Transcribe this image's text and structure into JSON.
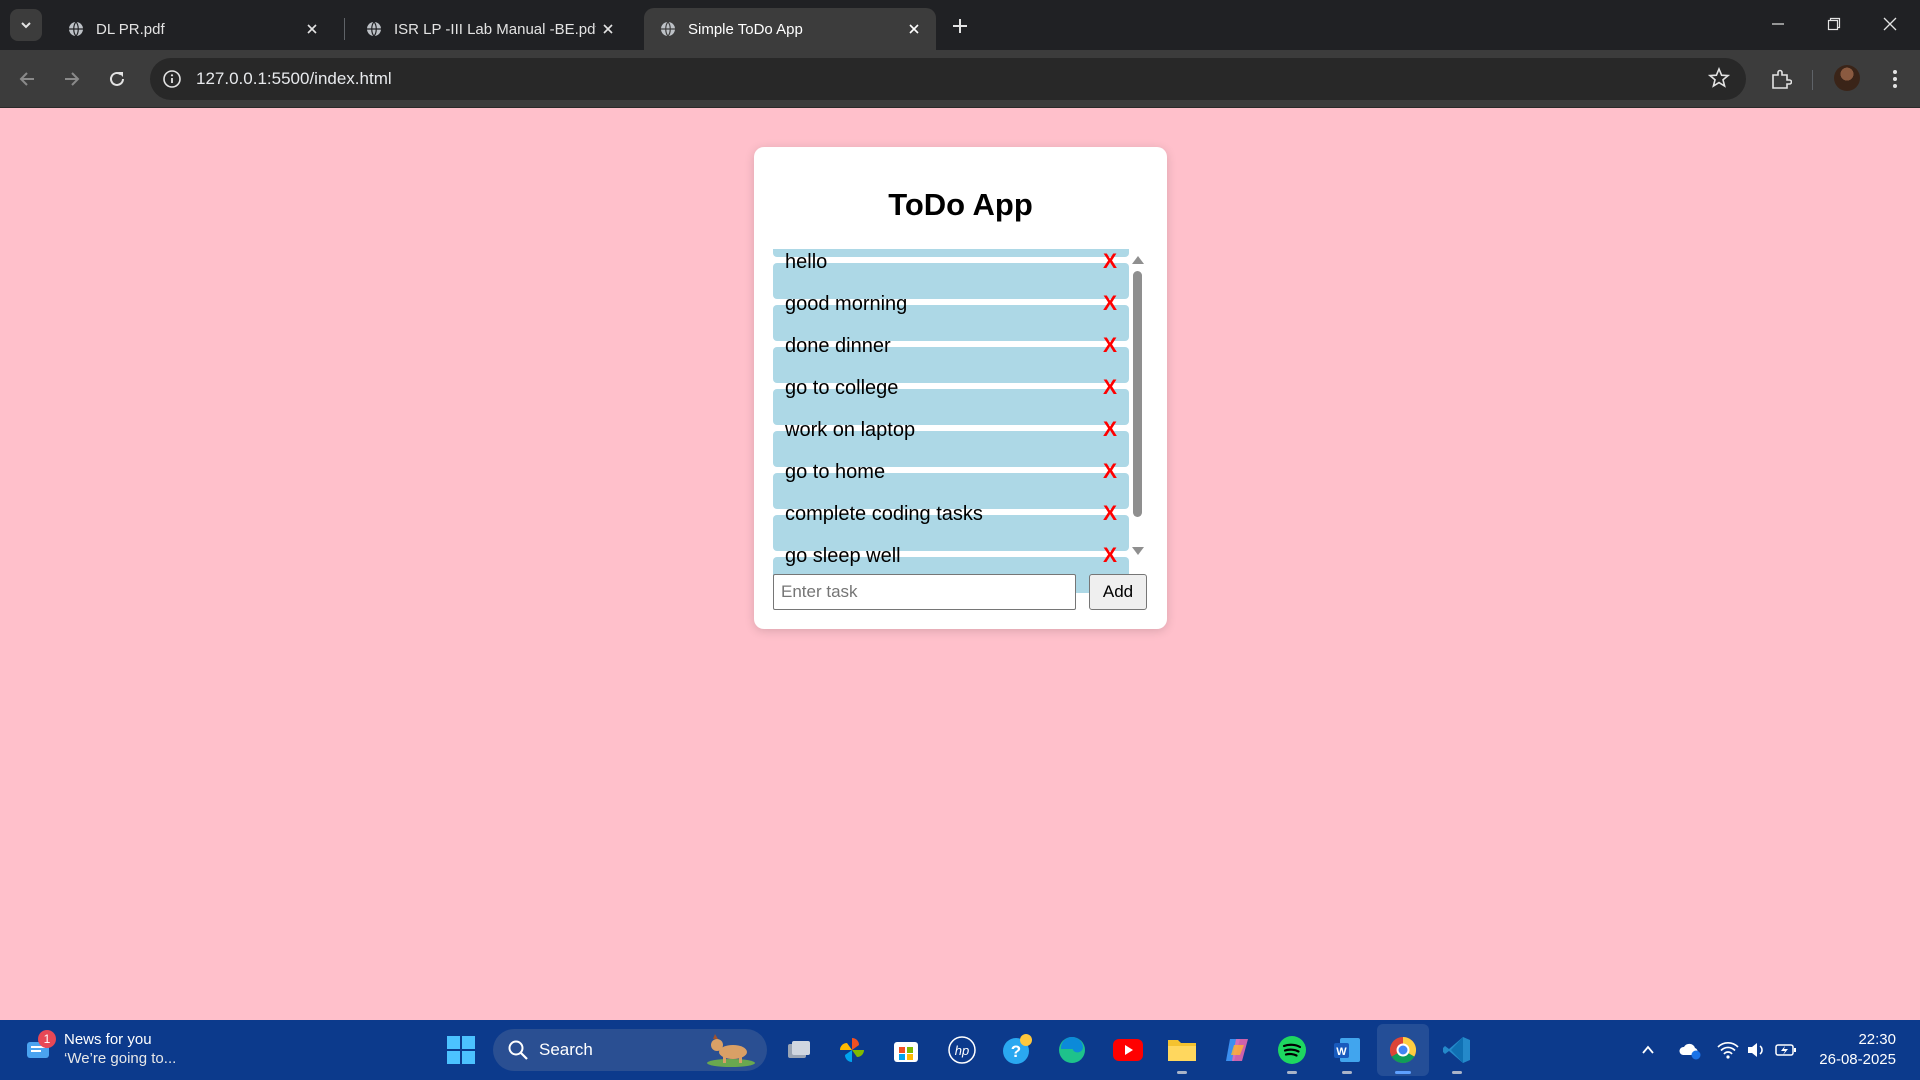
{
  "browser": {
    "tabs": [
      {
        "title": "DL PR.pdf",
        "active": false
      },
      {
        "title": "ISR LP -III Lab Manual -BE.pdf",
        "active": false
      },
      {
        "title": "Simple ToDo App",
        "active": true
      }
    ],
    "url": "127.0.0.1:5500/index.html"
  },
  "app": {
    "title": "ToDo App",
    "tasks": [
      "hello",
      "good morning",
      "done dinner",
      "go to college",
      "work on laptop",
      "go to home",
      "complete coding tasks",
      "go sleep well"
    ],
    "delete_label": "X",
    "input_placeholder": "Enter task",
    "input_value": "",
    "add_label": "Add"
  },
  "colors": {
    "page_background": "#ffc0cb",
    "item_background": "#add8e6",
    "delete_color": "#ff0000"
  },
  "taskbar": {
    "news_title": "News for you",
    "news_subtitle": "‘We’re going to...",
    "news_badge": "1",
    "search_label": "Search",
    "time": "22:30",
    "date": "26-08-2025",
    "apps": [
      "windows-start-icon",
      "task-view-icon",
      "photos-icon",
      "store-icon",
      "hp-icon",
      "help-icon",
      "edge-icon",
      "youtube-icon",
      "file-explorer-icon",
      "copilot-icon",
      "spotify-icon",
      "word-icon",
      "chrome-icon",
      "vscode-icon"
    ]
  }
}
